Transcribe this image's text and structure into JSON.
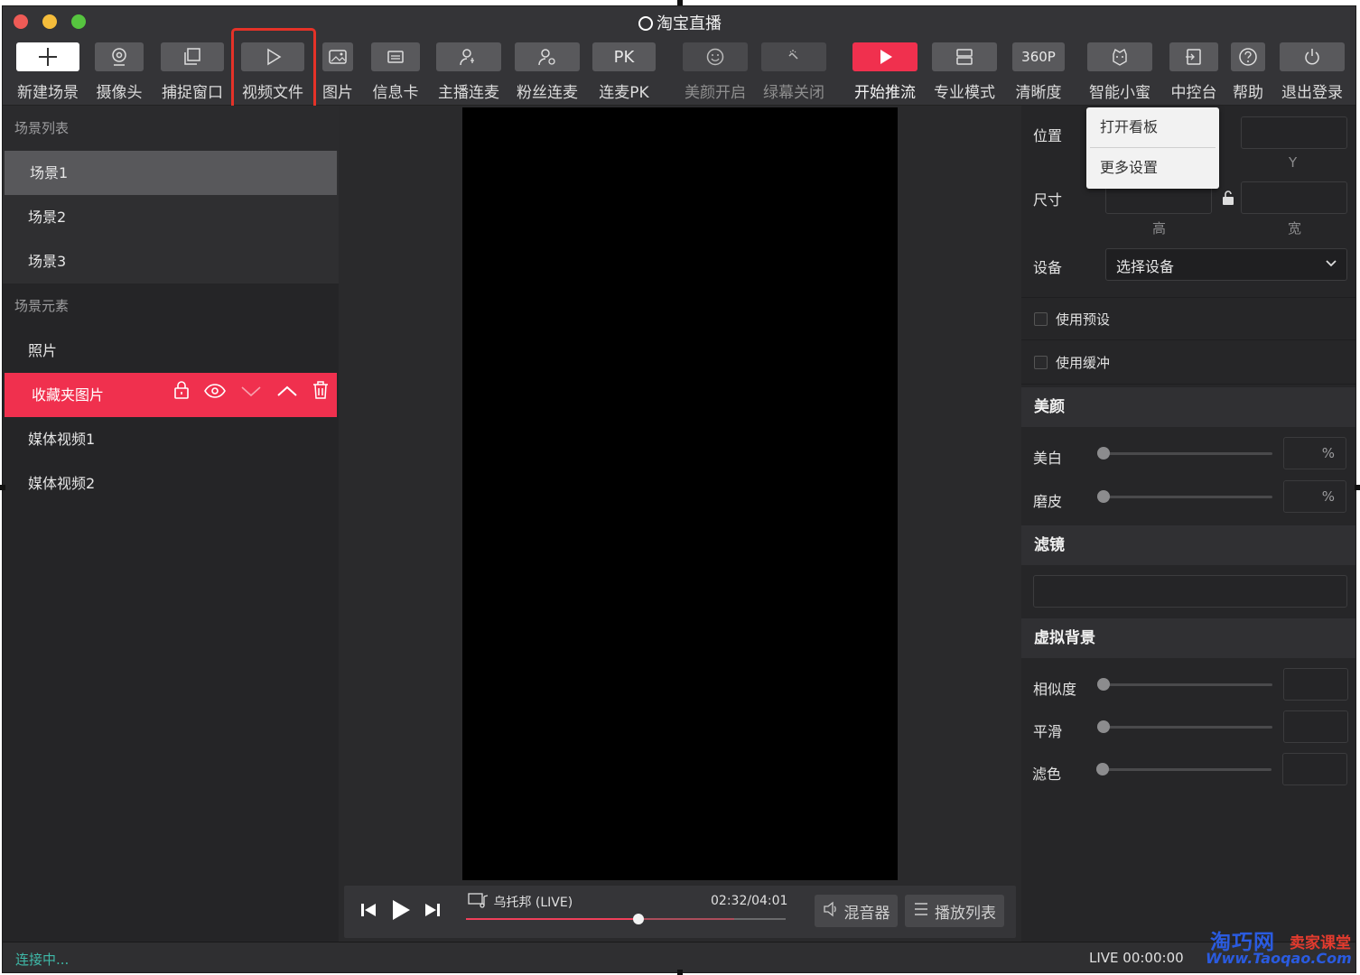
{
  "window": {
    "title": "淘宝直播",
    "traffic_lights": {
      "close": "#ee5b56",
      "minimize": "#f5bd3b",
      "zoom": "#56c43f"
    }
  },
  "toolbar": {
    "items": [
      {
        "label": "新建场景",
        "icon": "plus-icon"
      },
      {
        "label": "摄像头",
        "icon": "webcam-icon"
      },
      {
        "label": "捕捉窗口",
        "icon": "window-copy-icon"
      },
      {
        "label": "视频文件",
        "icon": "play-outline-icon"
      },
      {
        "label": "图片",
        "icon": "image-icon"
      },
      {
        "label": "信息卡",
        "icon": "card-icon"
      },
      {
        "label": "主播连麦",
        "icon": "user-mic-icon"
      },
      {
        "label": "粉丝连麦",
        "icon": "user-mic-alt-icon"
      },
      {
        "label": "连麦PK",
        "icon": "pk-text-icon",
        "badge": "PK"
      },
      {
        "label": "美颜开启",
        "icon": "smiley-icon"
      },
      {
        "label": "绿幕关闭",
        "icon": "magic-wand-icon"
      },
      {
        "label": "开始推流",
        "icon": "play-icon"
      },
      {
        "label": "专业模式",
        "icon": "server-icon"
      },
      {
        "label": "清晰度",
        "icon": "resolution-icon",
        "badge": "360P"
      },
      {
        "label": "智能小蜜",
        "icon": "bot-icon"
      },
      {
        "label": "中控台",
        "icon": "console-icon"
      },
      {
        "label": "帮助",
        "icon": "help-icon"
      },
      {
        "label": "退出登录",
        "icon": "power-icon"
      }
    ],
    "accent": "#f0304e",
    "highlight_color": "#e53228"
  },
  "left": {
    "scene_list_title": "场景列表",
    "scenes": [
      "场景1",
      "场景2",
      "场景3"
    ],
    "elements_title": "场景元素",
    "elements": [
      "照片",
      "收藏夹图片",
      "媒体视频1",
      "媒体视频2"
    ]
  },
  "player": {
    "song": "乌托邦 (LIVE)",
    "time": "02:32/04:01",
    "progress": 0.54,
    "buffered": 0.84,
    "mixer_label": "混音器",
    "playlist_label": "播放列表"
  },
  "right": {
    "position_label": "位置",
    "y_label": "Y",
    "size_label": "尺寸",
    "height_label": "高",
    "width_label": "宽",
    "device_label": "设备",
    "device_value": "选择设备",
    "use_preset": "使用预设",
    "use_buffer": "使用缓冲",
    "beauty_title": "美颜",
    "whiten_label": "美白",
    "smooth_skin_label": "磨皮",
    "percent": "%",
    "filter_title": "滤镜",
    "vbg_title": "虚拟背景",
    "similarity_label": "相似度",
    "smooth_label": "平滑",
    "color_filter_label": "滤色"
  },
  "popup": {
    "items": [
      "打开看板",
      "更多设置"
    ]
  },
  "status": {
    "connection": "连接中...",
    "live_time": "LIVE 00:00:00"
  },
  "watermark": {
    "brand": "淘巧网",
    "tag": "卖家课堂",
    "url": "Www.Taoqao.Com"
  }
}
